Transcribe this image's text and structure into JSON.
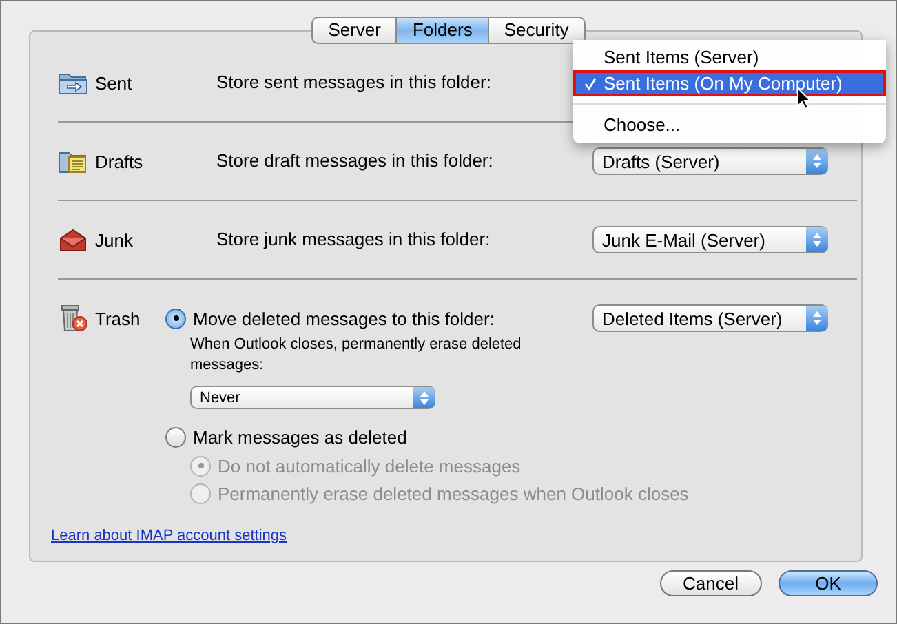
{
  "tabs": [
    {
      "label": "Server",
      "selected": false
    },
    {
      "label": "Folders",
      "selected": true
    },
    {
      "label": "Security",
      "selected": false
    }
  ],
  "folders": [
    {
      "label": "Sent",
      "prompt": "Store sent messages in this folder:",
      "menu_open": true
    },
    {
      "label": "Drafts",
      "prompt": "Store draft messages in this folder:",
      "popup": "Drafts (Server)"
    },
    {
      "label": "Junk",
      "prompt": "Store junk messages in this folder:",
      "popup": "Junk E-Mail (Server)"
    }
  ],
  "menu": [
    {
      "kind": "item",
      "label": "Sent Items (Server)",
      "selected": false
    },
    {
      "kind": "item",
      "label": "Sent Items (On My Computer)",
      "selected": true
    },
    {
      "kind": "separator"
    },
    {
      "kind": "item",
      "label": "Choose...",
      "selected": false
    }
  ],
  "trash": {
    "label": "Trash",
    "options": [
      {
        "label": "Move deleted messages to this folder:",
        "selected": true,
        "popup": "Deleted Items (Server)",
        "note": "When Outlook closes, permanently erase deleted messages:",
        "note_popup": "Never"
      },
      {
        "label": "Mark messages as deleted",
        "selected": false,
        "suboptions": [
          {
            "label": "Do not automatically delete messages",
            "selected": true,
            "disabled": true
          },
          {
            "label": "Permanently erase deleted messages when Outlook closes",
            "selected": false,
            "disabled": true
          }
        ]
      }
    ]
  },
  "link": "Learn about IMAP account settings",
  "buttons": [
    {
      "label": "Cancel",
      "default": false
    },
    {
      "label": "OK",
      "default": true
    }
  ]
}
